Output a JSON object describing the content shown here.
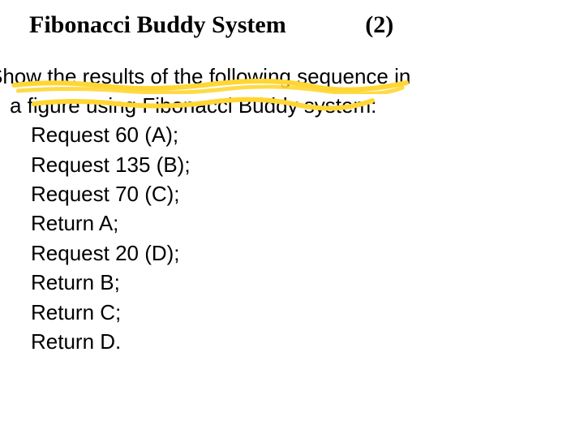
{
  "title": {
    "main": "Fibonacci Buddy System",
    "gap": "             ",
    "counter": "(2)"
  },
  "intro": {
    "line1": "Show the results of the following sequence in",
    "line2": "a figure using Fibonacci Buddy system:"
  },
  "lines": {
    "l1": "Request 60 (A);",
    "l2": "Request 135 (B);",
    "l3": "Request 70 (C);",
    "l4": "Return A;",
    "l5": "Request 20 (D);",
    "l6": "Return B;",
    "l7": "Return C;",
    "l8": "Return D."
  }
}
